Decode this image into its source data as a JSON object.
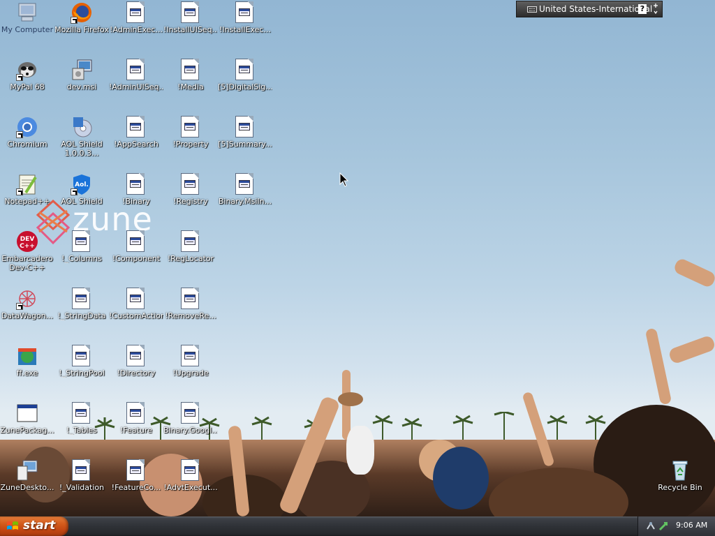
{
  "language_bar": {
    "language": "United States-International",
    "help_symbol": "?"
  },
  "taskbar": {
    "start_label": "start",
    "clock": "9:06 AM"
  },
  "wallpaper_logo": "zune",
  "desktop_icons": [
    {
      "id": "my-computer",
      "label": "My Computer",
      "icon": "computer-icon"
    },
    {
      "id": "mozilla-firefox",
      "label": "Mozilla Firefox",
      "icon": "firefox-icon"
    },
    {
      "id": "admin-exec",
      "label": "!AdminExec...",
      "icon": "table-document-icon"
    },
    {
      "id": "install-ui-seq",
      "label": "!InstallUISeq...",
      "icon": "table-document-icon"
    },
    {
      "id": "install-exec",
      "label": "!InstallExec...",
      "icon": "table-document-icon"
    },
    {
      "id": "mypal",
      "label": "MyPal 68",
      "icon": "mypal-raccoon-icon"
    },
    {
      "id": "dev-msi",
      "label": "dev.msi",
      "icon": "msi-installer-icon"
    },
    {
      "id": "admin-ui-seq",
      "label": "!AdminUISeq...",
      "icon": "table-document-icon"
    },
    {
      "id": "media",
      "label": "!Media",
      "icon": "table-document-icon"
    },
    {
      "id": "digital-sig",
      "label": "[5]DigitalSig...",
      "icon": "table-document-icon"
    },
    {
      "id": "chromium",
      "label": "Chromium",
      "icon": "chromium-icon"
    },
    {
      "id": "aol-shield-installer",
      "label": "AOL Shield 1.0.0.3...",
      "icon": "aol-installer-icon"
    },
    {
      "id": "app-search",
      "label": "!AppSearch",
      "icon": "table-document-icon"
    },
    {
      "id": "property",
      "label": "!Property",
      "icon": "table-document-icon"
    },
    {
      "id": "summary",
      "label": "[5]Summary...",
      "icon": "table-document-icon"
    },
    {
      "id": "notepadpp",
      "label": "Notepad++",
      "icon": "notepadpp-icon"
    },
    {
      "id": "aol-shield",
      "label": "AOL Shield",
      "icon": "aol-shield-icon"
    },
    {
      "id": "binary",
      "label": "!Binary",
      "icon": "table-document-icon"
    },
    {
      "id": "registry",
      "label": "!Registry",
      "icon": "table-document-icon"
    },
    {
      "id": "binary-msi",
      "label": "Binary.MsiIn...",
      "icon": "table-document-icon"
    },
    {
      "id": "embarcadero",
      "label": "Embarcadero Dev-C++",
      "icon": "devcpp-icon"
    },
    {
      "id": "columns",
      "label": "!_Columns",
      "icon": "table-document-icon"
    },
    {
      "id": "component",
      "label": "!Component",
      "icon": "table-document-icon"
    },
    {
      "id": "reg-locator",
      "label": "!RegLocator",
      "icon": "table-document-icon"
    },
    {
      "id": "datawagon",
      "label": "DataWagon...",
      "icon": "datawagon-icon"
    },
    {
      "id": "string-data",
      "label": "!_StringData",
      "icon": "table-document-icon"
    },
    {
      "id": "custom-action",
      "label": "!CustomAction",
      "icon": "table-document-icon"
    },
    {
      "id": "remove-re",
      "label": "!RemoveRe...",
      "icon": "table-document-icon"
    },
    {
      "id": "ff-exe",
      "label": "ff.exe",
      "icon": "ff-exe-icon"
    },
    {
      "id": "string-pool",
      "label": "!_StringPool",
      "icon": "table-document-icon"
    },
    {
      "id": "directory",
      "label": "!Directory",
      "icon": "table-document-icon"
    },
    {
      "id": "upgrade",
      "label": "!Upgrade",
      "icon": "table-document-icon"
    },
    {
      "id": "zune-package",
      "label": "ZunePackag...",
      "icon": "window-app-icon"
    },
    {
      "id": "tables",
      "label": "!_Tables",
      "icon": "table-document-icon"
    },
    {
      "id": "feature",
      "label": "!Feature",
      "icon": "table-document-icon"
    },
    {
      "id": "binary-google",
      "label": "Binary.Googl...",
      "icon": "table-document-icon"
    },
    {
      "id": "zune-desktop",
      "label": "ZuneDeskto...",
      "icon": "zune-desktop-icon"
    },
    {
      "id": "validation",
      "label": "!_Validation",
      "icon": "table-document-icon"
    },
    {
      "id": "feature-co",
      "label": "!FeatureCo...",
      "icon": "table-document-icon"
    },
    {
      "id": "advt-execute",
      "label": "!AdvtExecut...",
      "icon": "table-document-icon"
    },
    {
      "id": "recycle-bin",
      "label": "Recycle Bin",
      "icon": "recycle-bin-icon"
    }
  ]
}
